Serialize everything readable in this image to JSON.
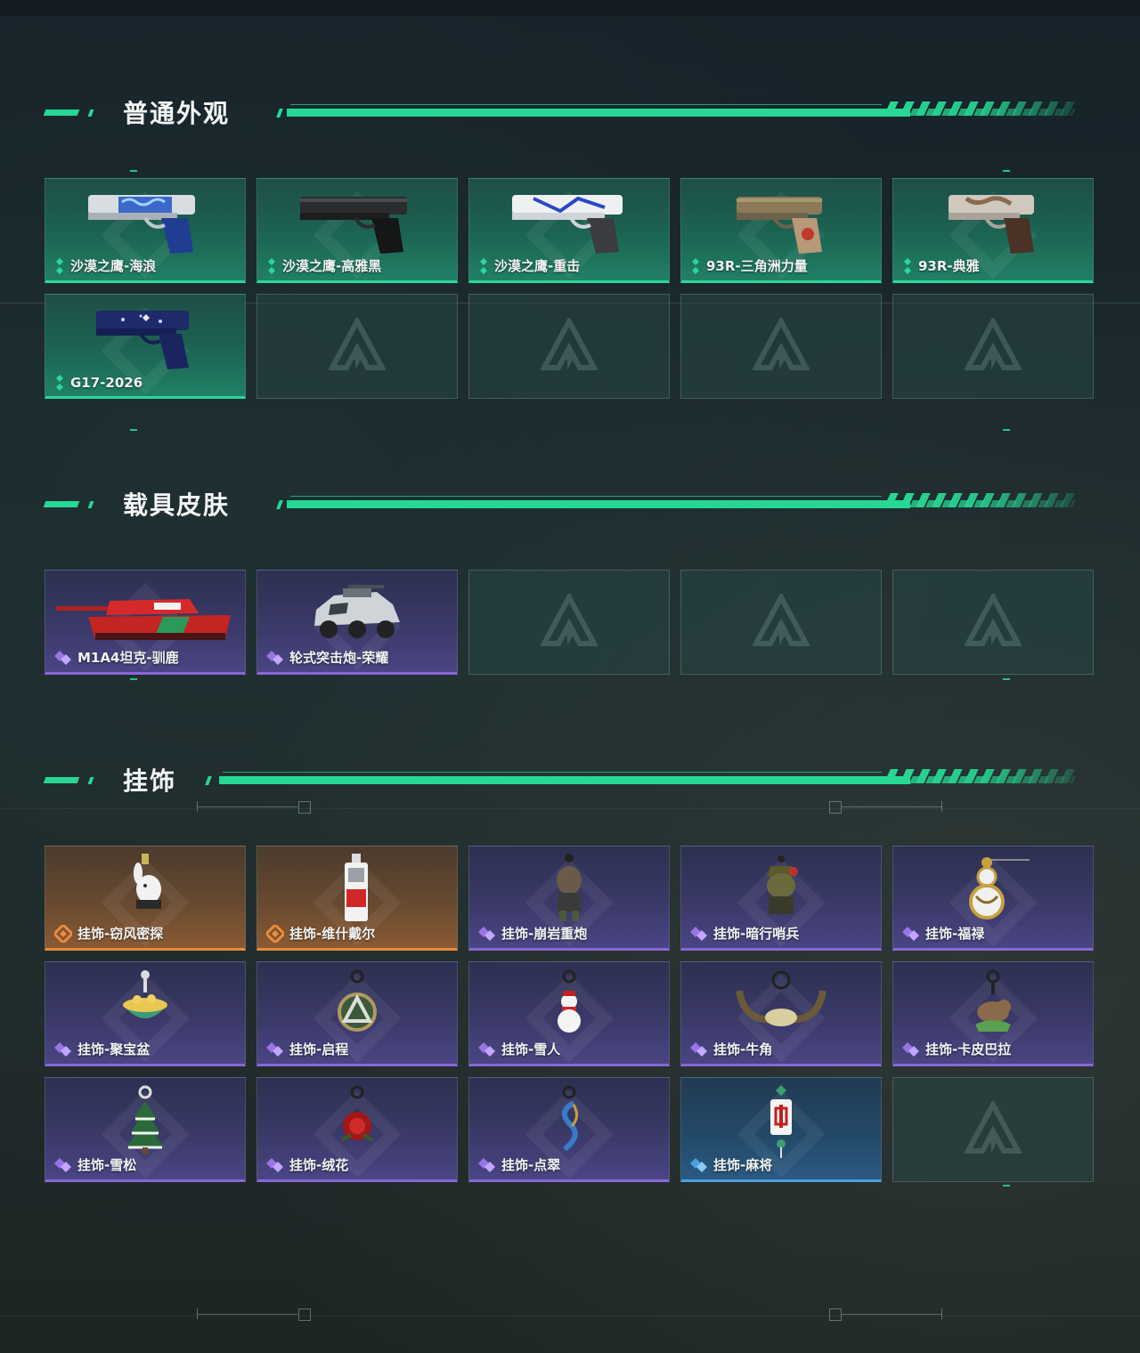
{
  "sections": [
    {
      "title": "普通外观"
    },
    {
      "title": "载具皮肤"
    },
    {
      "title": "挂饰"
    }
  ],
  "weapon_skins": [
    {
      "label": "沙漠之鹰-海浪",
      "icon": "pistol-blue-wave-icon"
    },
    {
      "label": "沙漠之鹰-高雅黑",
      "icon": "pistol-black-icon"
    },
    {
      "label": "沙漠之鹰-重击",
      "icon": "pistol-white-blue-icon"
    },
    {
      "label": "93R-三角洲力量",
      "icon": "pistol-tan-icon"
    },
    {
      "label": "93R-典雅",
      "icon": "pistol-silver-brown-icon"
    },
    {
      "label": "G17-2026",
      "icon": "pistol-navy-icon"
    }
  ],
  "vehicle_skins": [
    {
      "label": "M1A4坦克-驯鹿",
      "icon": "tank-red-icon"
    },
    {
      "label": "轮式突击炮-荣耀",
      "icon": "armored-car-icon"
    }
  ],
  "charms": [
    {
      "label": "挂饰-窃风密探",
      "icon": "rabbit-charm-icon",
      "rarity": "orange"
    },
    {
      "label": "挂饰-维什戴尔",
      "icon": "card-charm-icon",
      "rarity": "orange"
    },
    {
      "label": "挂饰-崩岩重炮",
      "icon": "figure-charm-icon",
      "rarity": "purple"
    },
    {
      "label": "挂饰-暗行哨兵",
      "icon": "soldier-charm-icon",
      "rarity": "purple"
    },
    {
      "label": "挂饰-福禄",
      "icon": "gourd-charm-icon",
      "rarity": "purple"
    },
    {
      "label": "挂饰-聚宝盆",
      "icon": "treasure-bowl-charm-icon",
      "rarity": "purple"
    },
    {
      "label": "挂饰-启程",
      "icon": "emblem-charm-icon",
      "rarity": "purple"
    },
    {
      "label": "挂饰-雪人",
      "icon": "snowman-charm-icon",
      "rarity": "purple"
    },
    {
      "label": "挂饰-牛角",
      "icon": "horns-charm-icon",
      "rarity": "purple"
    },
    {
      "label": "挂饰-卡皮巴拉",
      "icon": "capybara-charm-icon",
      "rarity": "purple"
    },
    {
      "label": "挂饰-雪松",
      "icon": "pine-charm-icon",
      "rarity": "purple"
    },
    {
      "label": "挂饰-绒花",
      "icon": "rose-charm-icon",
      "rarity": "purple"
    },
    {
      "label": "挂饰-点翠",
      "icon": "phoenix-charm-icon",
      "rarity": "purple"
    },
    {
      "label": "挂饰-麻将",
      "icon": "mahjong-charm-icon",
      "rarity": "blue"
    }
  ],
  "colors": {
    "accent": "#27d894",
    "green_card": "#218066",
    "purple_card": "#4a4584",
    "orange_card": "#8a5a33",
    "blue_card": "#2a5a82"
  }
}
